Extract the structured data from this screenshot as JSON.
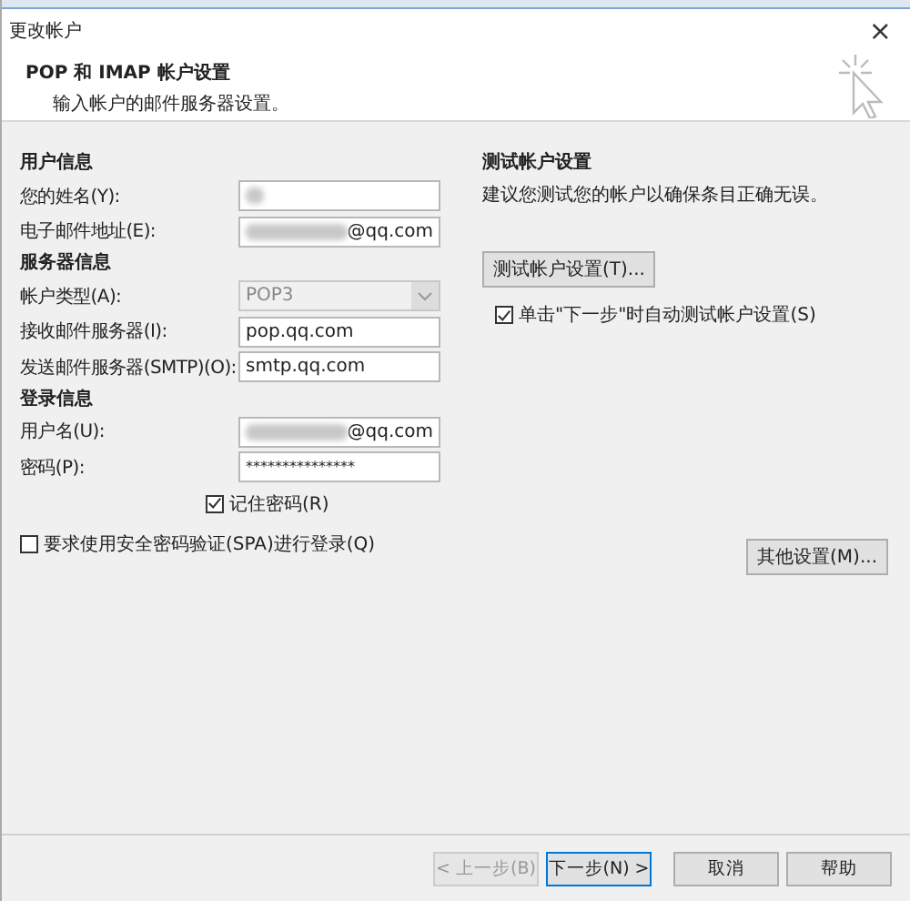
{
  "window": {
    "title": "更改帐户",
    "close": "×"
  },
  "header": {
    "title": "POP 和 IMAP 帐户设置",
    "subtitle": "输入帐户的邮件服务器设置。"
  },
  "sections": [
    {
      "heading": "用户信息",
      "fields": [
        {
          "label": "您的姓名(Y):",
          "kind": "text",
          "redacted": true
        },
        {
          "label": "电子邮件地址(E):",
          "kind": "text",
          "redacted": true,
          "value": "@qq.com"
        }
      ]
    },
    {
      "heading": "服务器信息",
      "fields": [
        {
          "label": "帐户类型(A):",
          "kind": "select",
          "disabled": true,
          "value": "POP3"
        },
        {
          "label": "接收邮件服务器(I):",
          "kind": "text",
          "value": "pop.qq.com"
        },
        {
          "label": "发送邮件服务器(SMTP)(O):",
          "kind": "text",
          "value": "smtp.qq.com"
        }
      ]
    },
    {
      "heading": "登录信息",
      "fields": [
        {
          "label": "用户名(U):",
          "kind": "text",
          "redacted": true,
          "value": "@qq.com"
        },
        {
          "label": "密码(P):",
          "kind": "password",
          "value": "***************"
        }
      ]
    }
  ],
  "remember": {
    "label": "记住密码(R)",
    "checked": true
  },
  "spa": {
    "label": "要求使用安全密码验证(SPA)进行登录(Q)",
    "checked": false
  },
  "test": {
    "heading": "测试帐户设置",
    "description": "建议您测试您的帐户以确保条目正确无误。",
    "button": "测试帐户设置(T)...",
    "auto": {
      "label": "单击\"下一步\"时自动测试帐户设置(S)",
      "checked": true
    }
  },
  "more_button": "其他设置(M)...",
  "buttons": [
    {
      "label": "< 上一步(B)",
      "disabled": true,
      "default": false
    },
    {
      "label": "下一步(N) >",
      "disabled": false,
      "default": true
    },
    {
      "label": "取消",
      "disabled": false,
      "default": false
    },
    {
      "label": "帮助",
      "disabled": false,
      "default": false
    }
  ]
}
